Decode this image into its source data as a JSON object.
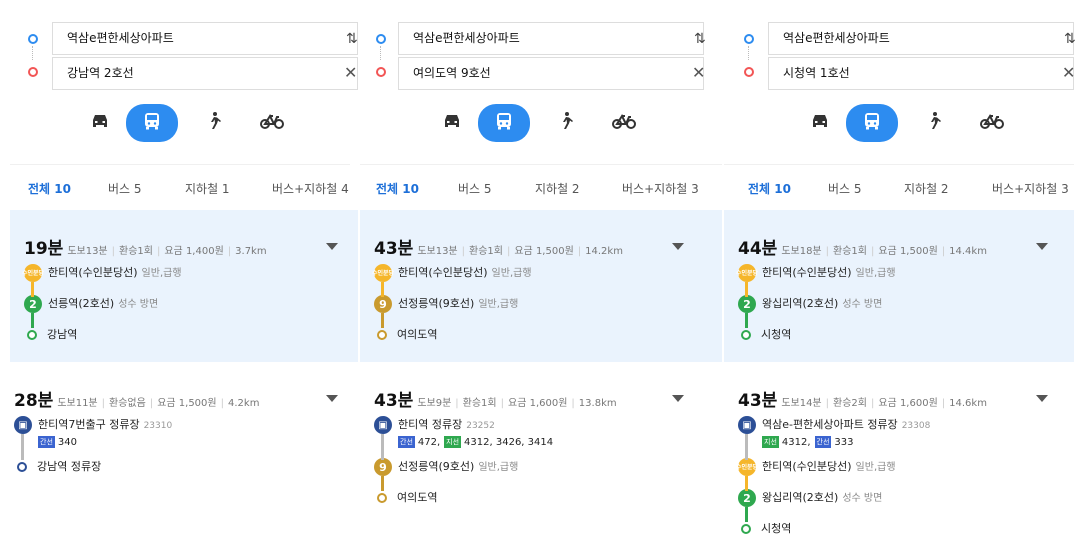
{
  "panels": [
    {
      "origin": "역삼e편한세상아파트",
      "destination": "강남역 2호선",
      "tabs": [
        "전체 10",
        "버스 5",
        "지하철 1",
        "버스+지하철 4"
      ],
      "routes": [
        {
          "time": "19분",
          "walk": "도보13분",
          "transfer": "환승1회",
          "fare": "요금 1,400원",
          "dist": "3.7km",
          "steps": [
            {
              "type": "line",
              "badge": "수인분당",
              "name": "한티역(수인분당선)",
              "sub": "일반,급행"
            },
            {
              "type": "line",
              "badge": "2",
              "name": "선릉역(2호선)",
              "sub": "성수 방면"
            },
            {
              "type": "end",
              "name": "강남역"
            }
          ]
        },
        {
          "time": "28분",
          "walk": "도보11분",
          "transfer": "환승없음",
          "fare": "요금 1,500원",
          "dist": "4.2km",
          "steps": [
            {
              "type": "bus",
              "name": "한티역7번출구 정류장",
              "num": "23310",
              "buses": [
                {
                  "kind": "간선",
                  "no": "340"
                }
              ]
            },
            {
              "type": "end",
              "name": "강남역 정류장"
            }
          ]
        }
      ]
    },
    {
      "origin": "역삼e편한세상아파트",
      "destination": "여의도역 9호선",
      "tabs": [
        "전체 10",
        "버스 5",
        "지하철 2",
        "버스+지하철 3"
      ],
      "routes": [
        {
          "time": "43분",
          "walk": "도보13분",
          "transfer": "환승1회",
          "fare": "요금 1,500원",
          "dist": "14.2km",
          "steps": [
            {
              "type": "line",
              "badge": "수인분당",
              "name": "한티역(수인분당선)",
              "sub": "일반,급행"
            },
            {
              "type": "line",
              "badge": "9",
              "name": "선정릉역(9호선)",
              "sub": "일반,급행"
            },
            {
              "type": "end",
              "name": "여의도역"
            }
          ]
        },
        {
          "time": "43분",
          "walk": "도보9분",
          "transfer": "환승1회",
          "fare": "요금 1,600원",
          "dist": "13.8km",
          "steps": [
            {
              "type": "bus",
              "name": "한티역 정류장",
              "num": "23252",
              "buses": [
                {
                  "kind": "간선",
                  "no": "472,"
                },
                {
                  "kind": "지선",
                  "no": "4312, 3426, 3414"
                }
              ]
            },
            {
              "type": "line",
              "badge": "9",
              "name": "선정릉역(9호선)",
              "sub": "일반,급행"
            },
            {
              "type": "end",
              "name": "여의도역"
            }
          ]
        }
      ]
    },
    {
      "origin": "역삼e편한세상아파트",
      "destination": "시청역 1호선",
      "tabs": [
        "전체 10",
        "버스 5",
        "지하철 2",
        "버스+지하철 3"
      ],
      "routes": [
        {
          "time": "44분",
          "walk": "도보18분",
          "transfer": "환승1회",
          "fare": "요금 1,500원",
          "dist": "14.4km",
          "steps": [
            {
              "type": "line",
              "badge": "수인분당",
              "name": "한티역(수인분당선)",
              "sub": "일반,급행"
            },
            {
              "type": "line",
              "badge": "2",
              "name": "왕십리역(2호선)",
              "sub": "성수 방면"
            },
            {
              "type": "end",
              "name": "시청역"
            }
          ]
        },
        {
          "time": "43분",
          "walk": "도보14분",
          "transfer": "환승2회",
          "fare": "요금 1,600원",
          "dist": "14.6km",
          "steps": [
            {
              "type": "bus",
              "name": "역삼e-편한세상아파트 정류장",
              "num": "23308",
              "buses": [
                {
                  "kind": "지선",
                  "no": "4312,"
                },
                {
                  "kind": "간선",
                  "no": "333"
                }
              ]
            },
            {
              "type": "line",
              "badge": "수인분당",
              "name": "한티역(수인분당선)",
              "sub": "일반,급행"
            },
            {
              "type": "line",
              "badge": "2",
              "name": "왕십리역(2호선)",
              "sub": "성수 방면"
            },
            {
              "type": "end",
              "name": "시청역"
            }
          ]
        }
      ]
    }
  ],
  "icons": {
    "car": "car-icon",
    "bus": "bus-icon",
    "walk": "walk-icon",
    "bike": "bike-icon",
    "swap": "swap-icon",
    "close": "close-icon",
    "caret": "chevron-down-icon"
  },
  "colors": {
    "accent": "#2d8cf0",
    "selected_bg": "#eaf3fd",
    "line2": "#2fa84f",
    "line9": "#c99a2e",
    "suin": "#f5b62b",
    "bus": "#2c4f96"
  }
}
